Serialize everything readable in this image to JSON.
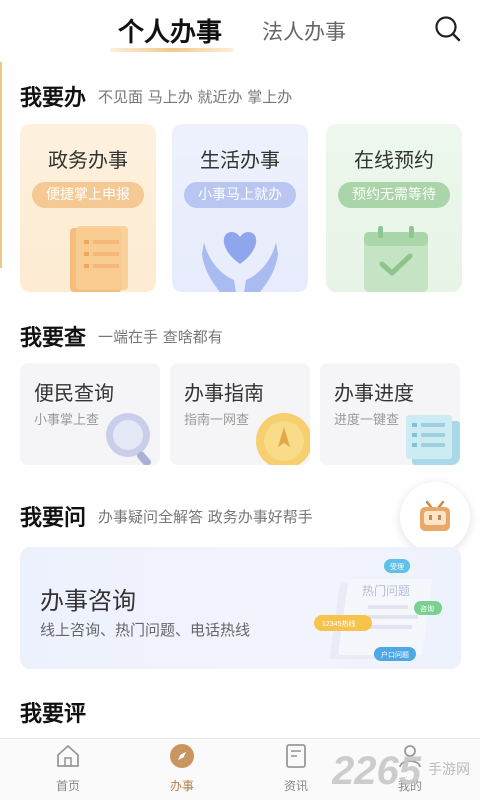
{
  "header": {
    "tabs": [
      {
        "label": "个人办事",
        "active": true
      },
      {
        "label": "法人办事",
        "active": false
      }
    ],
    "search_icon": "search-icon"
  },
  "sections": {
    "todo": {
      "title": "我要办",
      "subtitle": "不见面 马上办 就近办 掌上办",
      "cards": [
        {
          "title": "政务办事",
          "pill": "便捷掌上申报",
          "icon": "document-icon",
          "color": "#f4c994"
        },
        {
          "title": "生活办事",
          "pill": "小事马上就办",
          "icon": "heart-hands-icon",
          "color": "#b9c6f2"
        },
        {
          "title": "在线预约",
          "pill": "预约无需等待",
          "icon": "calendar-check-icon",
          "color": "#a9d5a9"
        }
      ]
    },
    "query": {
      "title": "我要查",
      "subtitle": "一端在手 查啥都有",
      "cards": [
        {
          "title": "便民查询",
          "sub": "小事掌上查",
          "icon": "magnifier-icon"
        },
        {
          "title": "办事指南",
          "sub": "指南一网查",
          "icon": "compass-coin-icon"
        },
        {
          "title": "办事进度",
          "sub": "进度一键查",
          "icon": "progress-list-icon"
        }
      ]
    },
    "ask": {
      "title": "我要问",
      "subtitle": "办事疑问全解答 政务办事好帮手",
      "card": {
        "title": "办事咨询",
        "sub": "线上咨询、热门问题、电话热线",
        "illus_labels": {
          "hot": "热门问题",
          "bubble_top": "受理",
          "bubble_right": "咨询",
          "bubble_left": "12345热线",
          "bubble_bottom": "户口问题"
        }
      }
    },
    "rate": {
      "title": "我要评"
    }
  },
  "robot": {
    "icon": "robot-assistant-icon"
  },
  "bottom_nav": [
    {
      "label": "首页",
      "icon": "home-icon",
      "active": false
    },
    {
      "label": "办事",
      "icon": "compass-icon",
      "active": true
    },
    {
      "label": "资讯",
      "icon": "news-icon",
      "active": false
    },
    {
      "label": "我的",
      "icon": "user-icon",
      "active": false
    }
  ],
  "watermark": {
    "number": "2265",
    "text": "手游网"
  },
  "colors": {
    "accent": "#f0c886",
    "nav_active": "#b5814a",
    "orange_card": "#fdf1de",
    "blue_card": "#eef1fd",
    "green_card": "#eef8ee"
  }
}
